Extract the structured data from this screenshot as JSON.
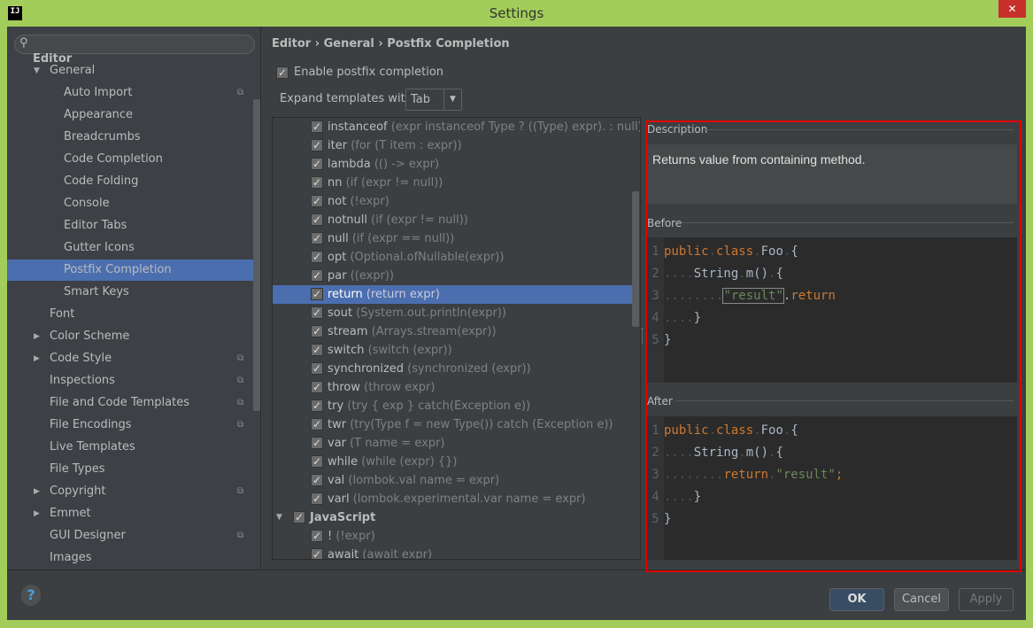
{
  "window": {
    "title": "Settings",
    "logo": "IJ",
    "close": "✕"
  },
  "sidebar": {
    "search_placeholder": "",
    "items": [
      {
        "label": "Editor",
        "level": 0,
        "bold": true
      },
      {
        "label": "General",
        "level": 1,
        "expanded": true
      },
      {
        "label": "Auto Import",
        "level": 2,
        "project": true
      },
      {
        "label": "Appearance",
        "level": 2
      },
      {
        "label": "Breadcrumbs",
        "level": 2
      },
      {
        "label": "Code Completion",
        "level": 2
      },
      {
        "label": "Code Folding",
        "level": 2
      },
      {
        "label": "Console",
        "level": 2
      },
      {
        "label": "Editor Tabs",
        "level": 2
      },
      {
        "label": "Gutter Icons",
        "level": 2
      },
      {
        "label": "Postfix Completion",
        "level": 2,
        "selected": true
      },
      {
        "label": "Smart Keys",
        "level": 2
      },
      {
        "label": "Font",
        "level": 1
      },
      {
        "label": "Color Scheme",
        "level": 1,
        "collapsed": true
      },
      {
        "label": "Code Style",
        "level": 1,
        "collapsed": true,
        "project": true
      },
      {
        "label": "Inspections",
        "level": 1,
        "project": true
      },
      {
        "label": "File and Code Templates",
        "level": 1,
        "project": true
      },
      {
        "label": "File Encodings",
        "level": 1,
        "project": true
      },
      {
        "label": "Live Templates",
        "level": 1
      },
      {
        "label": "File Types",
        "level": 1
      },
      {
        "label": "Copyright",
        "level": 1,
        "collapsed": true,
        "project": true
      },
      {
        "label": "Emmet",
        "level": 1,
        "collapsed": true
      },
      {
        "label": "GUI Designer",
        "level": 1,
        "project": true
      },
      {
        "label": "Images",
        "level": 1
      }
    ]
  },
  "breadcrumb": {
    "parts": [
      "Editor",
      "General",
      "Postfix Completion"
    ],
    "sep": "›"
  },
  "enable": {
    "label": "Enable postfix completion",
    "checked": true
  },
  "expand": {
    "label": "Expand templates with",
    "value": "Tab"
  },
  "templates": [
    {
      "key": "instanceof",
      "desc": "(expr instanceof Type ? ((Type) expr). : null)"
    },
    {
      "key": "iter",
      "desc": "(for (T item : expr))"
    },
    {
      "key": "lambda",
      "desc": "(() -> expr)"
    },
    {
      "key": "nn",
      "desc": "(if (expr != null))"
    },
    {
      "key": "not",
      "desc": "(!expr)"
    },
    {
      "key": "notnull",
      "desc": "(if (expr != null))"
    },
    {
      "key": "null",
      "desc": "(if (expr == null))"
    },
    {
      "key": "opt",
      "desc": "(Optional.ofNullable(expr))"
    },
    {
      "key": "par",
      "desc": "((expr))"
    },
    {
      "key": "return",
      "desc": "(return expr)",
      "selected": true
    },
    {
      "key": "sout",
      "desc": "(System.out.println(expr))"
    },
    {
      "key": "stream",
      "desc": "(Arrays.stream(expr))"
    },
    {
      "key": "switch",
      "desc": "(switch (expr))"
    },
    {
      "key": "synchronized",
      "desc": "(synchronized (expr))"
    },
    {
      "key": "throw",
      "desc": "(throw expr)"
    },
    {
      "key": "try",
      "desc": "(try { exp } catch(Exception e))"
    },
    {
      "key": "twr",
      "desc": "(try(Type f = new Type()) catch (Exception e))"
    },
    {
      "key": "var",
      "desc": "(T name = expr)"
    },
    {
      "key": "while",
      "desc": "(while (expr) {})"
    },
    {
      "key": "val",
      "desc": "(lombok.val name = expr)"
    },
    {
      "key": "varl",
      "desc": "(lombok.experimental.var name = expr)"
    },
    {
      "key": "JavaScript",
      "group": true
    },
    {
      "key": "!",
      "desc": "(!expr)"
    },
    {
      "key": "await",
      "desc": "(await expr)"
    }
  ],
  "right": {
    "description_label": "Description",
    "description": "Returns value from containing method.",
    "before_label": "Before",
    "after_label": "After",
    "highlight_color": "#e00000"
  },
  "footer": {
    "ok": "OK",
    "cancel": "Cancel",
    "apply": "Apply",
    "help": "?"
  }
}
